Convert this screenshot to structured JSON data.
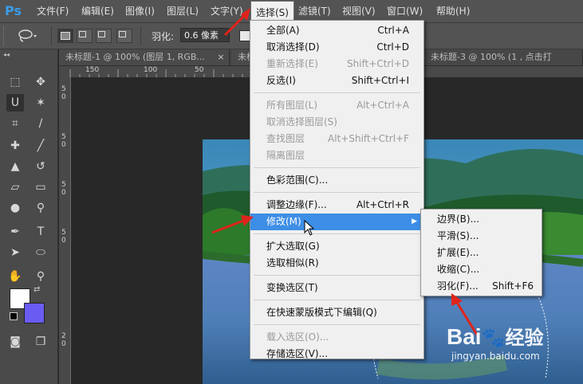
{
  "app": {
    "logo": "Ps"
  },
  "menubar": {
    "items": [
      "文件(F)",
      "编辑(E)",
      "图像(I)",
      "图层(L)",
      "文字(Y)",
      "选择(S)",
      "滤镜(T)",
      "视图(V)",
      "窗口(W)",
      "帮助(H)"
    ],
    "active": "选择(S)"
  },
  "options": {
    "feather_label": "羽化:",
    "feather_value": "0.6 像素"
  },
  "tabs": [
    {
      "title": "未标题-1 @ 100% (图层 1, RGB..."
    },
    {
      "title": "未标"
    },
    {
      "title": "未标题-3 @ 100% (1 , 点击打"
    }
  ],
  "ruler": {
    "top_numbers": [
      "150",
      "100",
      "50"
    ],
    "left_numbers": [
      "5",
      "0",
      "5",
      "0",
      "5",
      "0",
      "5",
      "0",
      "2",
      "0"
    ]
  },
  "select_menu": {
    "groups": [
      [
        {
          "label": "全部(A)",
          "shortcut": "Ctrl+A",
          "disabled": false
        },
        {
          "label": "取消选择(D)",
          "shortcut": "Ctrl+D",
          "disabled": false
        },
        {
          "label": "重新选择(E)",
          "shortcut": "Shift+Ctrl+D",
          "disabled": true
        },
        {
          "label": "反选(I)",
          "shortcut": "Shift+Ctrl+I",
          "disabled": false
        }
      ],
      [
        {
          "label": "所有图层(L)",
          "shortcut": "Alt+Ctrl+A",
          "disabled": true
        },
        {
          "label": "取消选择图层(S)",
          "shortcut": "",
          "disabled": true
        },
        {
          "label": "查找图层",
          "shortcut": "Alt+Shift+Ctrl+F",
          "disabled": true
        },
        {
          "label": "隔离图层",
          "shortcut": "",
          "disabled": true
        }
      ],
      [
        {
          "label": "色彩范围(C)...",
          "shortcut": "",
          "disabled": false
        }
      ],
      [
        {
          "label": "调整边缘(F)...",
          "shortcut": "Alt+Ctrl+R",
          "disabled": false
        },
        {
          "label": "修改(M)",
          "shortcut": "",
          "disabled": false,
          "highlighted": true,
          "submenu": true
        }
      ],
      [
        {
          "label": "扩大选取(G)",
          "shortcut": "",
          "disabled": false
        },
        {
          "label": "选取相似(R)",
          "shortcut": "",
          "disabled": false
        }
      ],
      [
        {
          "label": "变换选区(T)",
          "shortcut": "",
          "disabled": false
        }
      ],
      [
        {
          "label": "在快速蒙版模式下编辑(Q)",
          "shortcut": "",
          "disabled": false
        }
      ],
      [
        {
          "label": "载入选区(O)...",
          "shortcut": "",
          "disabled": true
        },
        {
          "label": "存储选区(V)...",
          "shortcut": "",
          "disabled": false
        }
      ]
    ]
  },
  "modify_submenu": {
    "items": [
      {
        "label": "边界(B)...",
        "shortcut": ""
      },
      {
        "label": "平滑(S)...",
        "shortcut": ""
      },
      {
        "label": "扩展(E)...",
        "shortcut": ""
      },
      {
        "label": "收缩(C)...",
        "shortcut": ""
      },
      {
        "label": "羽化(F)...",
        "shortcut": "Shift+F6"
      }
    ]
  },
  "watermark": {
    "brand": "Bai",
    "brand2": "经验",
    "url": "jingyan.baidu.com"
  },
  "colors": {
    "menu_highlight": "#3d8ee6",
    "background_swatch": "#6a5cf3",
    "foreground_swatch": "#ffffff",
    "arrow": "#e0241b"
  }
}
